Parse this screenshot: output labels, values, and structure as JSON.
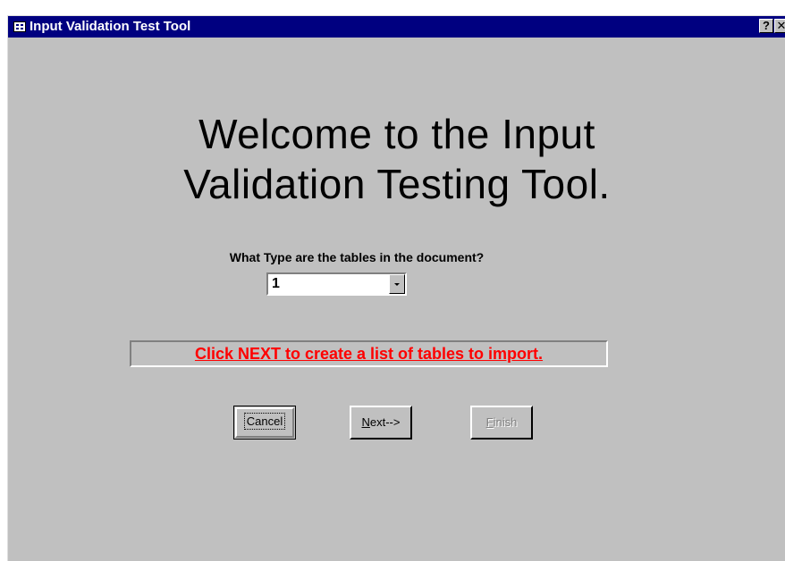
{
  "window": {
    "title": "Input Validation Test Tool",
    "help_label": "?",
    "close_label": "✕"
  },
  "main": {
    "welcome_line1": "Welcome to the Input",
    "welcome_line2": "Validation Testing Tool.",
    "question": "What Type are the tables in the document?",
    "table_type_value": "1",
    "info_text": "Click NEXT to create a list of tables to import."
  },
  "buttons": {
    "cancel_label": "Cancel",
    "next_label_mnemonic": "N",
    "next_label_rest": "ext-->",
    "finish_label_mnemonic": "F",
    "finish_label_rest": "inish"
  },
  "colors": {
    "title_bar": "#000080",
    "dialog_face": "#c0c0c0",
    "info_text": "#ff0000"
  }
}
